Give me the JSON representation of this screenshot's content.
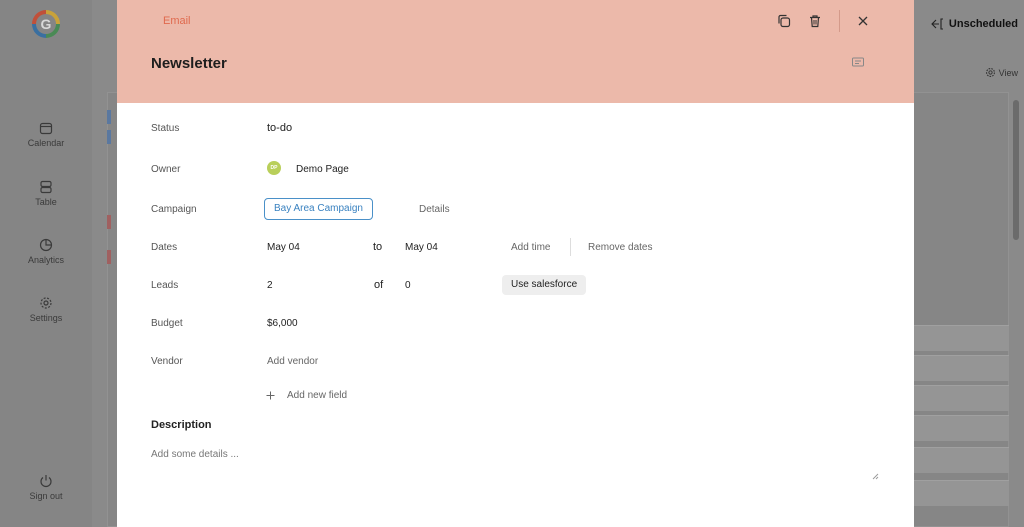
{
  "background": {
    "logo_letter": "G",
    "nav": [
      {
        "label": "Calendar",
        "icon": "calendar-icon"
      },
      {
        "label": "Table",
        "icon": "table-icon"
      },
      {
        "label": "Analytics",
        "icon": "analytics-icon"
      },
      {
        "label": "Settings",
        "icon": "settings-icon"
      }
    ],
    "signout_label": "Sign out",
    "unscheduled_label": "Unscheduled",
    "view_label": "View"
  },
  "modal": {
    "type_label": "Email",
    "title": "Newsletter",
    "header_color": "#ecb9aa",
    "accent_color": "#e06a4e",
    "fields": {
      "status": {
        "label": "Status",
        "value": "to-do"
      },
      "owner": {
        "label": "Owner",
        "initials": "DP",
        "value": "Demo Page"
      },
      "campaign": {
        "label": "Campaign",
        "value": "Bay Area Campaign",
        "details_label": "Details"
      },
      "dates": {
        "label": "Dates",
        "start": "May 04",
        "to_label": "to",
        "end": "May 04",
        "add_time_label": "Add time",
        "remove_dates_label": "Remove dates"
      },
      "leads": {
        "label": "Leads",
        "value": "2",
        "of_label": "of",
        "total": "0",
        "salesforce_label": "Use salesforce"
      },
      "budget": {
        "label": "Budget",
        "value": "$6,000"
      },
      "vendor": {
        "label": "Vendor",
        "placeholder": "Add vendor"
      }
    },
    "add_field_label": "Add new field",
    "description": {
      "title": "Description",
      "placeholder": "Add some details ..."
    }
  }
}
